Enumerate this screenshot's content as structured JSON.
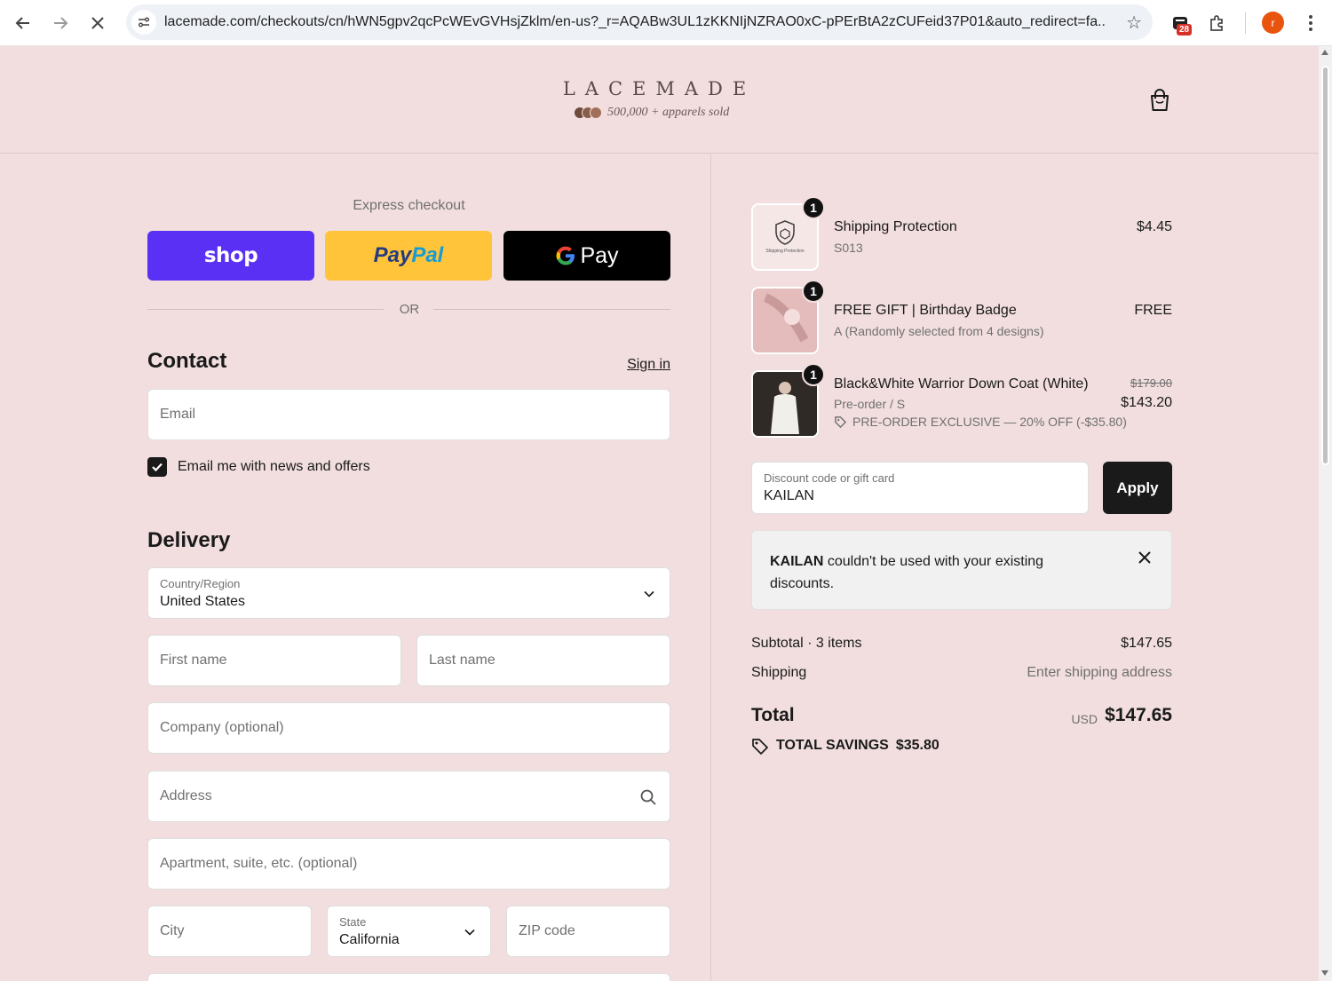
{
  "browser": {
    "url": "lacemade.com/checkouts/cn/hWN5gpv2qcPcWEvGVHsjZklm/en-us?_r=AQABw3UL1zKKNIjNZRAO0xC-pPErBtA2zCUFeid37P01&auto_redirect=fa...",
    "extension_badge": "28",
    "profile_initial": "r"
  },
  "store": {
    "logo": "LACEMADE",
    "tagline": "500,000 + apparels sold"
  },
  "express": {
    "label": "Express checkout",
    "shop": "shop",
    "paypal_a": "Pay",
    "paypal_b": "Pal",
    "gpay": "Pay",
    "or": "OR"
  },
  "contact": {
    "heading": "Contact",
    "sign_in": "Sign in",
    "email_placeholder": "Email",
    "newsletter_label": "Email me with news and offers",
    "newsletter_checked": true
  },
  "delivery": {
    "heading": "Delivery",
    "country_label": "Country/Region",
    "country_value": "United States",
    "first_name": "First name",
    "last_name": "Last name",
    "company": "Company (optional)",
    "address": "Address",
    "apartment": "Apartment, suite, etc. (optional)",
    "city": "City",
    "state_label": "State",
    "state_value": "California",
    "zip": "ZIP code"
  },
  "cart": {
    "items": [
      {
        "qty": "1",
        "name": "Shipping Protection",
        "variant": "S013",
        "price": "$4.45"
      },
      {
        "qty": "1",
        "name": "FREE GIFT | Birthday Badge",
        "variant": "A (Randomly selected from 4 designs)",
        "price": "FREE"
      },
      {
        "qty": "1",
        "name": "Black&White Warrior Down Coat (White)",
        "variant": "Pre-order / S",
        "original_price": "$179.00",
        "price": "$143.20",
        "promo": "PRE-ORDER EXCLUSIVE — 20% OFF (-$35.80)"
      }
    ],
    "thumb_caption": "Shipping Protection"
  },
  "discount": {
    "label": "Discount code or gift card",
    "value": "KAILAN",
    "apply": "Apply",
    "notice_code": "KAILAN",
    "notice_text": " couldn't be used with your existing discounts."
  },
  "summary": {
    "subtotal_label": "Subtotal · 3 items",
    "subtotal_value": "$147.65",
    "shipping_label": "Shipping",
    "shipping_value": "Enter shipping address",
    "total_label": "Total",
    "currency": "USD",
    "total_value": "$147.65",
    "savings_label": "TOTAL SAVINGS",
    "savings_value": "$35.80"
  },
  "colors": {
    "page_bg": "#f2dede",
    "shop_pay": "#5a31f4",
    "paypal": "#ffc439",
    "gpay": "#000000"
  }
}
